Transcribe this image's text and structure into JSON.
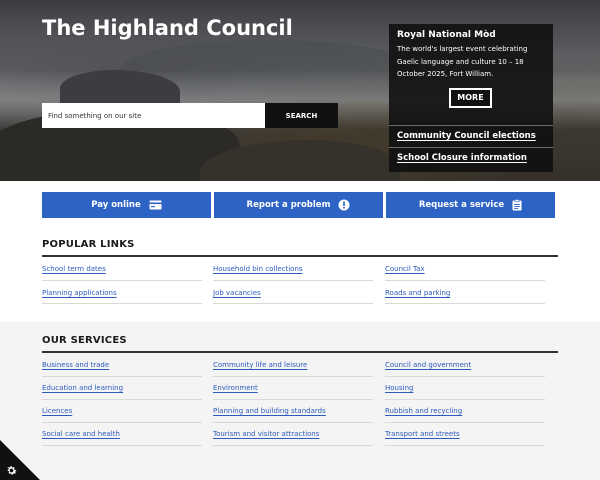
{
  "site": {
    "title": "The Highland Council"
  },
  "search": {
    "placeholder": "Find something on our site",
    "button_label": "SEARCH"
  },
  "promo": {
    "title": "Royal National Mòd",
    "text": "The world's largest event celebrating Gaelic language and culture 10 – 18 October 2025, Fort William.",
    "more_label": "MORE",
    "links": [
      "Community Council elections",
      "School Closure information"
    ]
  },
  "actions": [
    {
      "label": "Pay online",
      "icon": "card-icon"
    },
    {
      "label": "Report a problem",
      "icon": "alert-icon"
    },
    {
      "label": "Request a service",
      "icon": "clipboard-icon"
    }
  ],
  "popular": {
    "heading": "POPULAR LINKS",
    "links": [
      "School term dates",
      "Household bin collections",
      "Council Tax",
      "Planning applications",
      "Job vacancies",
      "Roads and parking"
    ]
  },
  "services": {
    "heading": "OUR SERVICES",
    "links": [
      "Business and trade",
      "Community life and leisure",
      "Council and government",
      "Education and learning",
      "Environment",
      "Housing",
      "Licences",
      "Planning and building standards",
      "Rubbish and recycling",
      "Social care and health",
      "Tourism and visitor attractions",
      "Transport and streets"
    ]
  },
  "cookie": {
    "icon": "gear-icon"
  },
  "colors": {
    "action_blue": "#2e63c6",
    "link_blue": "#2c5bbd",
    "hero_dark": "#111111"
  }
}
